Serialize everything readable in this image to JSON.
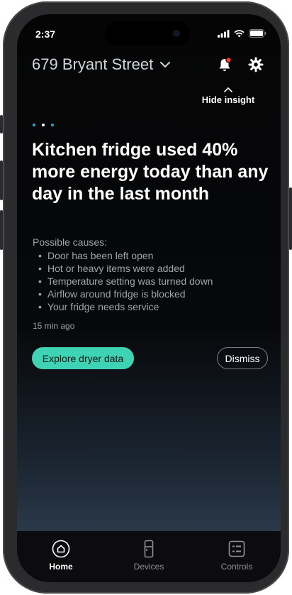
{
  "status_bar": {
    "time": "2:37"
  },
  "header": {
    "address": "679 Bryant Street"
  },
  "insight_toggle": {
    "label": "Hide insight"
  },
  "carousel": {
    "count": 3,
    "active_index": 1
  },
  "insight": {
    "headline": "Kitchen fridge used 40% more energy today than any day in the last month",
    "causes_title": "Possible causes:",
    "causes": [
      "Door has been left open",
      "Hot or heavy items were added",
      "Temperature setting was turned down",
      "Airflow around fridge is blocked",
      "Your fridge needs service"
    ],
    "timestamp": "15 min ago"
  },
  "actions": {
    "explore_label": "Explore dryer data",
    "dismiss_label": "Dismiss"
  },
  "tabs": [
    {
      "label": "Home",
      "icon": "home-icon",
      "active": true
    },
    {
      "label": "Devices",
      "icon": "devices-icon",
      "active": false
    },
    {
      "label": "Controls",
      "icon": "controls-icon",
      "active": false
    }
  ],
  "colors": {
    "accent": "#3fd3b5",
    "notification_dot": "#ff3b30",
    "dot_inactive": "#2aa9c9"
  }
}
